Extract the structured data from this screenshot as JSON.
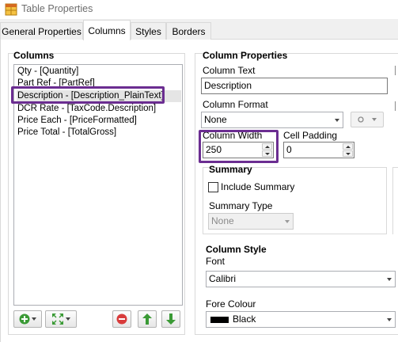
{
  "window": {
    "title": "Table Properties",
    "app_icon": "table-grid-icon"
  },
  "tabs": [
    {
      "label": "General Properties",
      "active": false
    },
    {
      "label": "Columns",
      "active": true
    },
    {
      "label": "Styles",
      "active": false
    },
    {
      "label": "Borders",
      "active": false
    }
  ],
  "columns_group": {
    "title": "Columns",
    "items": [
      "Qty - [Quantity]",
      "Part Ref - [PartRef]",
      "Description - [Description_PlainText]",
      "DCR Rate - [TaxCode.Description]",
      "Price Each - [PriceFormatted]",
      "Price Total - [TotalGross]"
    ],
    "selected_index": 2,
    "toolbar_icons": [
      "add-column-icon",
      "expand-arrows-icon",
      "remove-column-icon",
      "move-up-icon",
      "move-down-icon"
    ]
  },
  "column_properties": {
    "title": "Column Properties",
    "column_text_label": "Column Text",
    "column_text_value": "Description",
    "column_format_label": "Column Format",
    "column_format_value": "None",
    "column_width_label": "Column Width",
    "column_width_value": "250",
    "cell_padding_label": "Cell Padding",
    "cell_padding_value": "0"
  },
  "summary": {
    "title": "Summary",
    "include_summary_label": "Include Summary",
    "include_summary_checked": false,
    "summary_type_label": "Summary Type",
    "summary_type_value": "None"
  },
  "column_style": {
    "title": "Column Style",
    "font_label": "Font",
    "font_value": "Calibri",
    "fore_colour_label": "Fore Colour",
    "fore_colour_value": "Black",
    "fore_colour_swatch": "#000000"
  },
  "colors": {
    "highlight": "#6b2d91",
    "add_green": "#3a9a35",
    "remove_red": "#d83b3b"
  }
}
